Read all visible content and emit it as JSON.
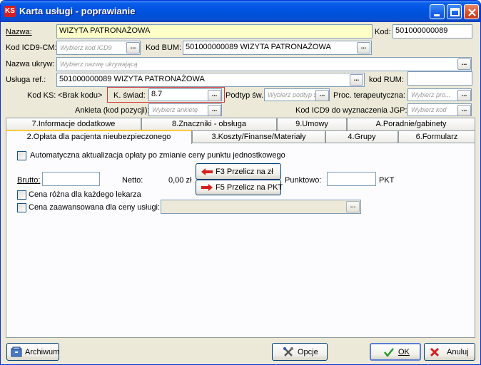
{
  "window": {
    "title": "Karta usługi - poprawianie",
    "app_icon_text": "KS"
  },
  "form": {
    "nazwa_label": "Nazwa:",
    "nazwa_value": "WIZYTA PATRONAŻOWA",
    "kod_label": "Kod:",
    "kod_value": "501000000089",
    "icd9_label": "Kod ICD9-CM:",
    "icd9_placeholder": "Wybierz kod ICD9",
    "bum_label": "Kod BUM:",
    "bum_value": "501000000089 WIZYTA PATRONAŻOWA",
    "ukryw_label": "Nazwa ukryw:",
    "ukryw_placeholder": "Wybierz nazwę ukrywającą",
    "usluga_ref_label": "Usługa ref.:",
    "usluga_ref_value": "501000000089 WIZYTA PATRONAŻOWA",
    "rum_label": "kod RUM:",
    "rum_value": "",
    "kodks_label": "Kod KS:",
    "kodks_value": "<Brak kodu>",
    "kswiad_label": "K. świad:",
    "kswiad_value": "8.7",
    "podtyp_label": "Podtyp św.:",
    "podtyp_placeholder": "Wybierz podtyp świa...",
    "proc_label": "Proc. terapeutyczna:",
    "proc_placeholder": "Wybierz pro...",
    "ankieta_label": "Ankieta (kod pozycji):",
    "ankieta_placeholder": "Wybierz ankietę",
    "icd9_jgp_label": "Kod ICD9 do wyznaczenia JGP:",
    "icd9_jgp_placeholder": "Wybierz kod",
    "dots": "..."
  },
  "tabs_row1": [
    "7.Informacje dodatkowe",
    "8.Znaczniki - obsługa",
    "9.Umowy",
    "A.Poradnie/gabinety"
  ],
  "tabs_row2": [
    "2.Opłata dla pacjenta nieubezpieczonego",
    "3.Koszty/Finanse/Materiały",
    "4.Grupy",
    "6.Formularz"
  ],
  "panel": {
    "auto_update_label": "Automatyczna aktualizacja opłaty po zmianie ceny punktu jednostkowego",
    "brutto_label": "Brutto:",
    "brutto_value": "",
    "netto_label": "Netto:",
    "netto_value": "0,00 zł",
    "f3_label": "F3 Przelicz na zł",
    "f5_label": "F5 Przelicz na PKT",
    "punktowo_label": "Punktowo:",
    "punktowo_value": "",
    "pkt_label": "PKT",
    "cena_rozna_label": "Cena różna dla każdego lekarza",
    "cena_zaaw_label": "Cena zaawansowana dla ceny usługi:"
  },
  "footer": {
    "archiwum_label": "Archiwum",
    "opcje_label": "Opcje",
    "ok_label": "OK",
    "anuluj_label": "Anuluj"
  }
}
